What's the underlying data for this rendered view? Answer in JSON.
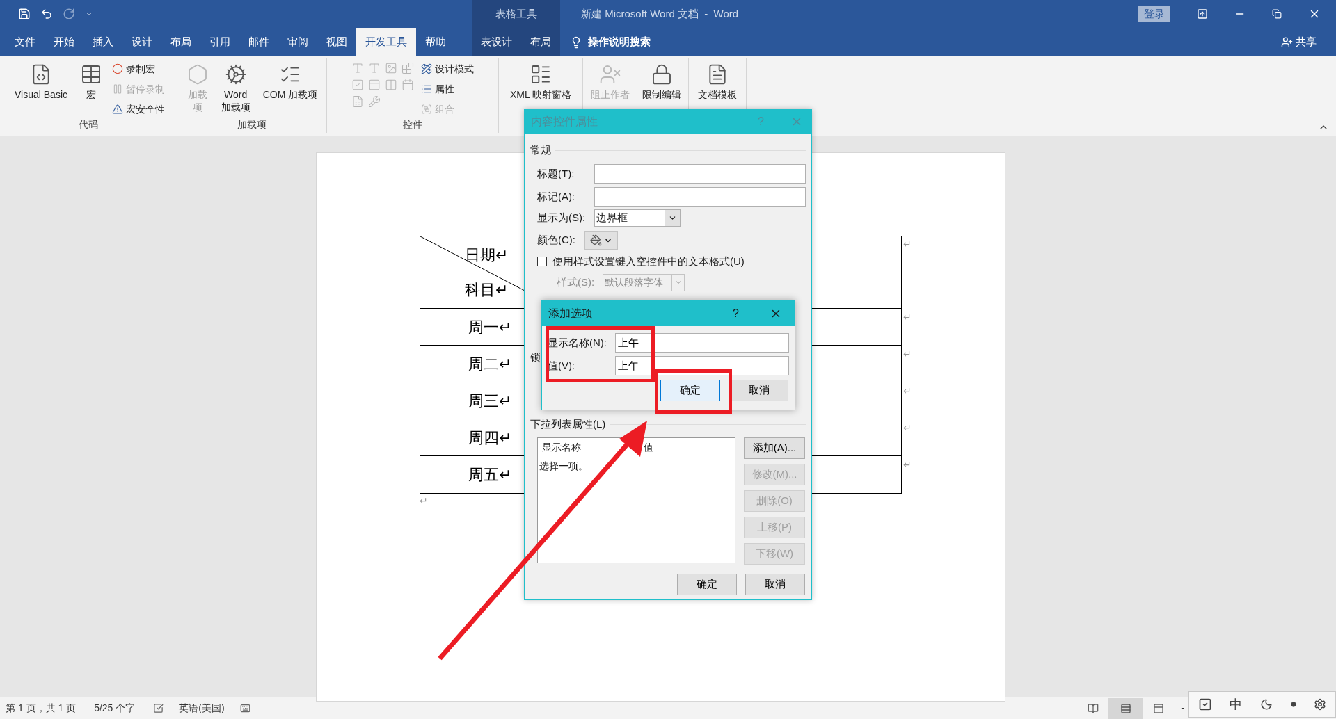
{
  "title_bar": {
    "context_label": "表格工具",
    "title": "新建 Microsoft Word 文档  -  Word",
    "sign_in": "登录"
  },
  "tabs": [
    {
      "label": "文件",
      "selected": false,
      "context": false
    },
    {
      "label": "开始",
      "selected": false,
      "context": false
    },
    {
      "label": "插入",
      "selected": false,
      "context": false
    },
    {
      "label": "设计",
      "selected": false,
      "context": false
    },
    {
      "label": "布局",
      "selected": false,
      "context": false
    },
    {
      "label": "引用",
      "selected": false,
      "context": false
    },
    {
      "label": "邮件",
      "selected": false,
      "context": false
    },
    {
      "label": "审阅",
      "selected": false,
      "context": false
    },
    {
      "label": "视图",
      "selected": false,
      "context": false
    },
    {
      "label": "开发工具",
      "selected": true,
      "context": false
    },
    {
      "label": "帮助",
      "selected": false,
      "context": false
    },
    {
      "label": "表设计",
      "selected": false,
      "context": true
    },
    {
      "label": "布局",
      "selected": false,
      "context": true
    }
  ],
  "search": {
    "label": "操作说明搜索"
  },
  "share": "共享",
  "ribbon_groups": [
    {
      "label": "代码",
      "items": [
        {
          "kind": "large",
          "label": "Visual Basic",
          "disabled": false
        },
        {
          "kind": "large",
          "label": "宏",
          "disabled": false
        },
        {
          "kind": "small",
          "label": "录制宏",
          "disabled": false
        },
        {
          "kind": "small",
          "label": "暂停录制",
          "disabled": true
        },
        {
          "kind": "small",
          "label": "宏安全性",
          "disabled": false
        }
      ]
    },
    {
      "label": "加载项",
      "items": [
        {
          "kind": "large",
          "label": "加载项",
          "disabled": true
        },
        {
          "kind": "large",
          "label": "Word 加载项",
          "disabled": false
        },
        {
          "kind": "large",
          "label": "COM 加载项",
          "disabled": false
        }
      ]
    },
    {
      "label": "控件",
      "items": [
        {
          "kind": "icon",
          "disabled": true
        },
        {
          "kind": "icon",
          "disabled": true
        },
        {
          "kind": "icon",
          "disabled": true
        },
        {
          "kind": "icon",
          "disabled": true
        },
        {
          "kind": "icon",
          "disabled": true
        },
        {
          "kind": "icon",
          "disabled": true
        },
        {
          "kind": "icon",
          "disabled": true
        },
        {
          "kind": "icon",
          "disabled": true
        },
        {
          "kind": "icon",
          "disabled": true
        },
        {
          "kind": "icon",
          "disabled": true
        },
        {
          "kind": "small",
          "label": "设计模式",
          "disabled": false
        },
        {
          "kind": "small",
          "label": "属性",
          "disabled": false
        },
        {
          "kind": "small",
          "label": "组合",
          "disabled": true
        }
      ]
    },
    {
      "items": [
        {
          "kind": "large",
          "label": "XML 映射窗格",
          "disabled": false
        }
      ]
    },
    {
      "items": [
        {
          "kind": "large",
          "label": "阻止作者",
          "disabled": true
        },
        {
          "kind": "large",
          "label": "限制编辑",
          "disabled": false
        }
      ]
    },
    {
      "items": [
        {
          "kind": "large",
          "label": "文档模板",
          "disabled": false
        }
      ]
    }
  ],
  "table": {
    "header": {
      "top": "日期↵",
      "bottom": "科目↵",
      "end_mark": "↵"
    },
    "rows": [
      {
        "label": "周一↵",
        "end_mark": "↵"
      },
      {
        "label": "周二↵",
        "end_mark": "↵"
      },
      {
        "label": "周三↵",
        "end_mark": "↵"
      },
      {
        "label": "周四↵",
        "end_mark": "↵"
      },
      {
        "label": "周五↵",
        "end_mark": "↵"
      }
    ],
    "after_mark": "↵"
  },
  "properties_dialog": {
    "title": "内容控件属性",
    "help": "?",
    "section_general": "常规",
    "title_field": {
      "label": "标题(T):"
    },
    "tag_field": {
      "label": "标记(A):"
    },
    "show_as": {
      "label": "显示为(S):",
      "value": "边界框"
    },
    "color": {
      "label": "颜色(C):"
    },
    "use_style": {
      "label": "使用样式设置键入空控件中的文本格式(U)",
      "checked": false
    },
    "style": {
      "label": "样式(S):",
      "value": "默认段落字体",
      "disabled": true
    },
    "locking_label": "锁",
    "section_list": "下拉列表属性(L)",
    "list_columns": [
      "显示名称",
      "值"
    ],
    "list_rows": [
      "选择一项。"
    ],
    "side_buttons": [
      {
        "label": "添加(A)...",
        "disabled": false
      },
      {
        "label": "修改(M)...",
        "disabled": true
      },
      {
        "label": "删除(O)",
        "disabled": true
      },
      {
        "label": "上移(P)",
        "disabled": true
      },
      {
        "label": "下移(W)",
        "disabled": true
      }
    ],
    "ok": "确定",
    "cancel": "取消"
  },
  "add_dialog": {
    "title": "添加选项",
    "help": "?",
    "name_field": {
      "label": "显示名称(N):",
      "value": "上午"
    },
    "value_field": {
      "label": "值(V):",
      "value": "上午"
    },
    "ok": "确定",
    "cancel": "取消"
  },
  "status_bar": {
    "page": "第 1 页，共 1 页",
    "words": "5/25 个字",
    "language": "英语(美国)",
    "zoom_out": "-"
  },
  "ime_bar": {
    "mode": "中"
  }
}
